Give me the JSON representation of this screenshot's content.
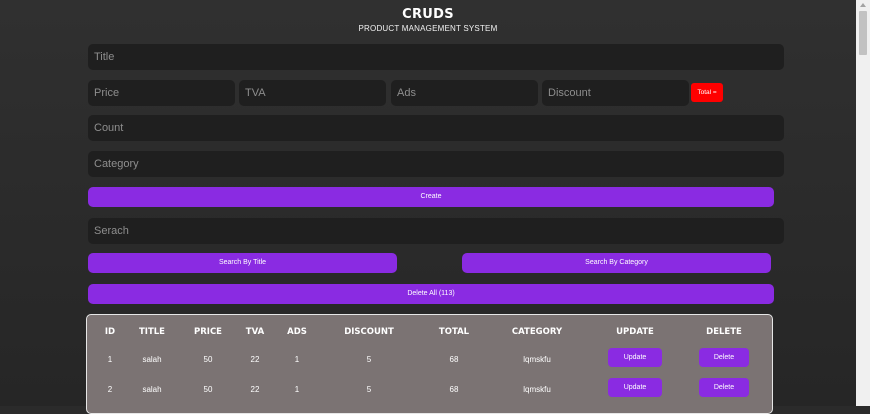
{
  "header": {
    "title": "CRUDS",
    "subtitle": "PRODUCT MANAGEMENT SYSTEM"
  },
  "form": {
    "title_placeholder": "Title",
    "price_placeholder": "Price",
    "tva_placeholder": "TVA",
    "ads_placeholder": "Ads",
    "discount_placeholder": "Discount",
    "total_label": "Total =",
    "count_placeholder": "Count",
    "category_placeholder": "Category",
    "create_label": "Create"
  },
  "search": {
    "placeholder": "Serach",
    "by_title_label": "Search By Title",
    "by_category_label": "Search By Category"
  },
  "delete_all_label": "Delete All (113)",
  "table": {
    "headers": {
      "id": "ID",
      "title": "TITLE",
      "price": "PRICE",
      "tva": "TVA",
      "ads": "ADS",
      "discount": "DISCOUNT",
      "total": "TOTAL",
      "category": "CATEGORY",
      "update": "UPDATE",
      "delete": "DELETE"
    },
    "rows": [
      {
        "id": "1",
        "title": "salah",
        "price": "50",
        "tva": "22",
        "ads": "1",
        "discount": "5",
        "total": "68",
        "category": "lqmskfu",
        "update": "Update",
        "delete": "Delete"
      },
      {
        "id": "2",
        "title": "salah",
        "price": "50",
        "tva": "22",
        "ads": "1",
        "discount": "5",
        "total": "68",
        "category": "lqmskfu",
        "update": "Update",
        "delete": "Delete"
      }
    ]
  },
  "colors": {
    "accent": "#8a2be2",
    "total_badge": "#ff0000",
    "table_bg": "#7b7373",
    "input_bg": "#1f1f1f"
  }
}
